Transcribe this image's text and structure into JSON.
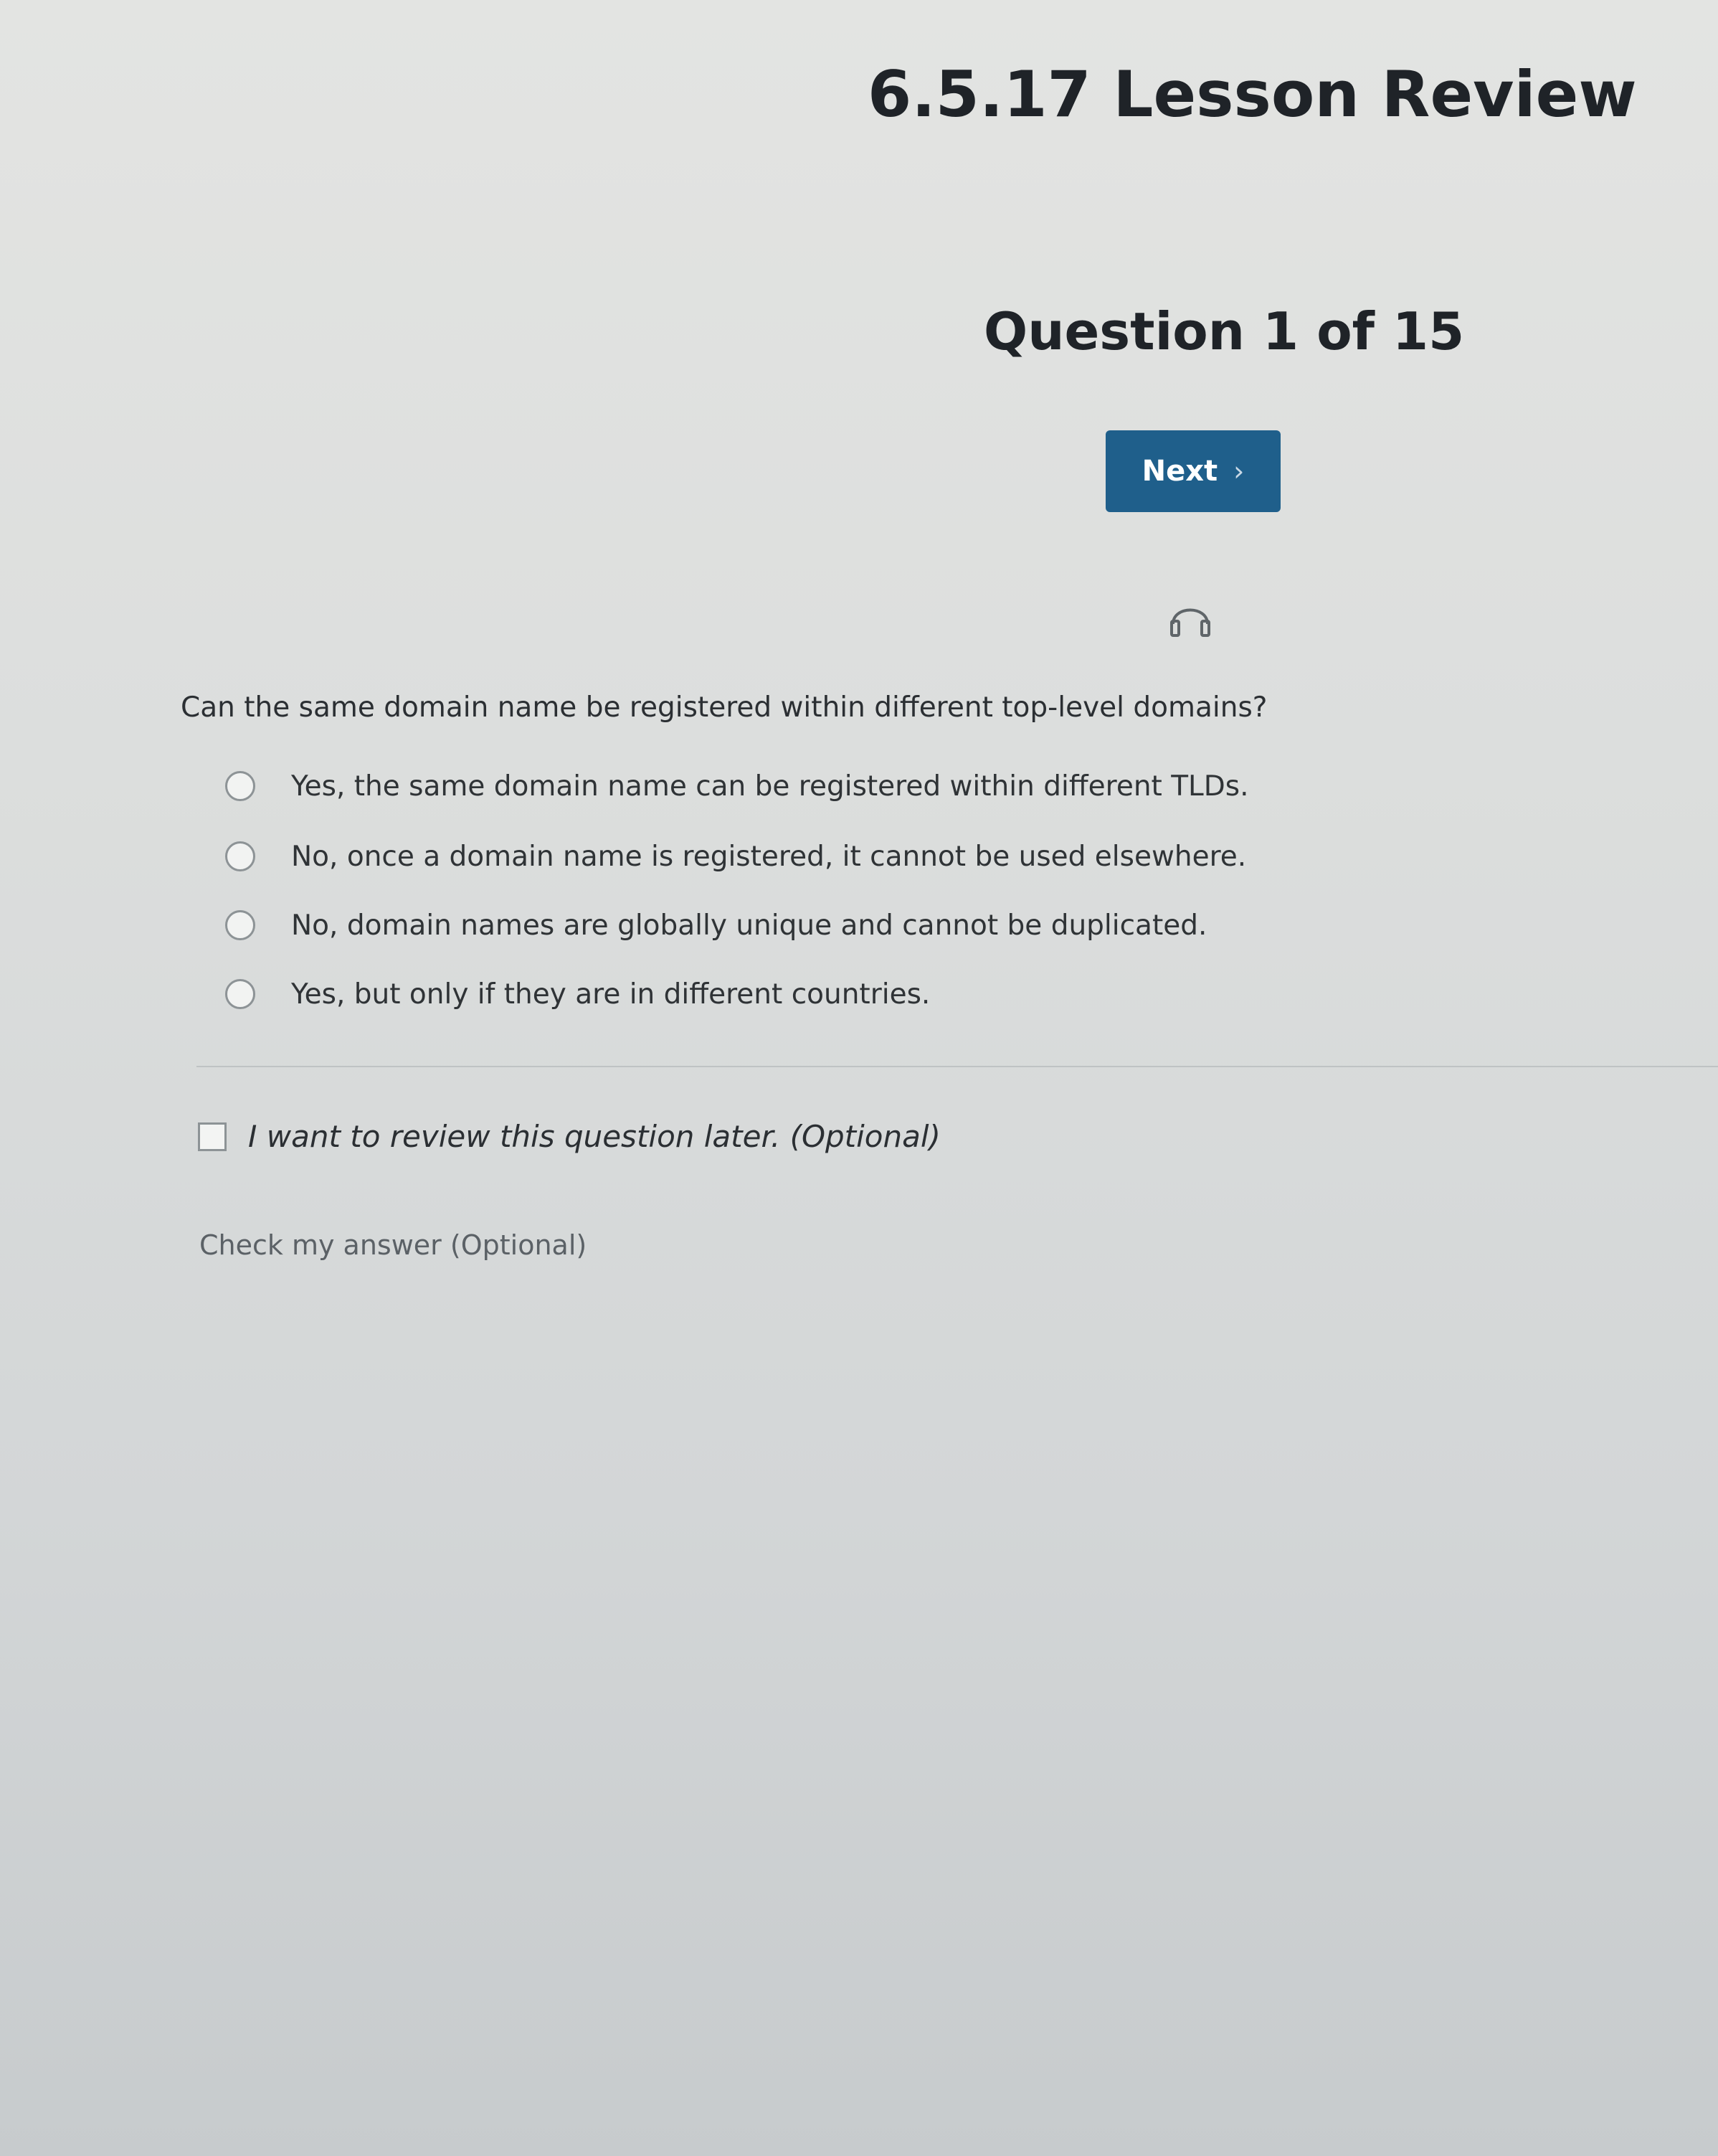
{
  "header": {
    "title": "6.5.17 Lesson Review",
    "question_counter": "Question 1 of 15",
    "next_label": "Next",
    "next_chevron": "›",
    "audio_icon": "headphones-icon"
  },
  "question": {
    "text": "Can the same domain name be registered within different top-level domains?",
    "options": [
      {
        "label": "Yes, the same domain name can be registered within different TLDs.",
        "selected": false
      },
      {
        "label": "No, once a domain name is registered, it cannot be used elsewhere.",
        "selected": false
      },
      {
        "label": "No, domain names are globally unique and cannot be duplicated.",
        "selected": false
      },
      {
        "label": "Yes, but only if they are in different countries.",
        "selected": false
      }
    ]
  },
  "footer": {
    "review_later_label": "I want to review this question later. (Optional)",
    "review_later_checked": false,
    "check_answer_label": "Check my answer (Optional)"
  },
  "colors": {
    "accent": "#1f5f8b",
    "background": "#dcdedd",
    "text": "#2b2f33"
  }
}
